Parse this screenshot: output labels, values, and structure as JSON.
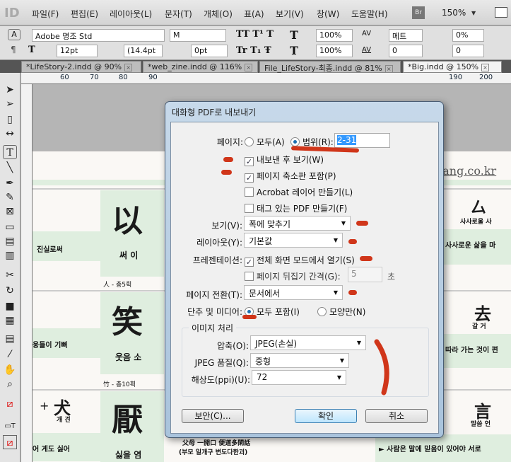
{
  "menubar": {
    "items": [
      "파일(F)",
      "편집(E)",
      "레이아웃(L)",
      "문자(T)",
      "개체(O)",
      "표(A)",
      "보기(V)",
      "창(W)",
      "도움말(H)"
    ],
    "bridge": "Br",
    "zoom": "150%"
  },
  "control": {
    "font": "Adobe 명조 Std",
    "style": "M",
    "size": "12pt",
    "leading": "(14.4pt",
    "baseline": "0pt",
    "vscale": "100%",
    "hscale": "100%",
    "kerning": "메트",
    "tracking": "0",
    "tsume": "0%",
    "grid": "0"
  },
  "tabs": [
    "*LifeStory-2.indd @ 90%",
    "*web_zine.indd @ 116%",
    "File_LifeStory-최종.indd @ 81%",
    "*Big.indd @ 150%"
  ],
  "ruler": [
    "60",
    "70",
    "80",
    "90",
    "190",
    "200"
  ],
  "document": {
    "url": "bang.co.kr",
    "c1": "以",
    "c1r": "써 이",
    "c1a": "진실로써",
    "c1f": "人 - 총5획",
    "c2": "笑",
    "c2r": "웃음 소",
    "c2a": "웅들이 기뻐",
    "c2f": "竹 - 총10획",
    "c3": "厭",
    "c3r": "싫을 염",
    "c3a": "어 게도 싫어",
    "c3b": "犬",
    "c3bl": "개 견",
    "r1": "厶",
    "r1l": "사사로울 사",
    "r1a": "사사로운 삶을 마",
    "r2": "去",
    "r2l": "갈 거",
    "r2a": "따라 가는 것이 편",
    "r3": "言",
    "r3l": "말씀 언",
    "r3a": "► 사람은 말에 믿음이 있어야 서로",
    "mid1": "父母 一開口 便道多閑話",
    "mid2": "(부모 일개구 변도다한괴)"
  },
  "dialog": {
    "title": "대화형 PDF로 내보내기",
    "pages_label": "페이지:",
    "all": "모두(A)",
    "range": "범위(R):",
    "range_value": "2-31",
    "view_after": "내보낸 후 보기(W)",
    "thumbs": "페이지 축소판 포함(P)",
    "layers": "Acrobat 레이어 만들기(L)",
    "tagged": "태그 있는 PDF 만들기(F)",
    "view_label": "보기(V):",
    "view_value": "폭에 맞추기",
    "layout_label": "레이아웃(Y):",
    "layout_value": "기본값",
    "pres_label": "프레젠테이션:",
    "fullscreen": "전체 화면 모드에서 열기(S)",
    "flip": "페이지 뒤집기 간격(G):",
    "flip_value": "5",
    "sec": "초",
    "trans_label": "페이지 전환(T):",
    "trans_value": "문서에서",
    "btn_label": "단추 및 미디어:",
    "include_all": "모두 포함(I)",
    "appearance": "모양만(N)",
    "image_group": "이미지 처리",
    "comp_label": "압축(O):",
    "comp_value": "JPEG(손실)",
    "quality_label": "JPEG 품질(Q):",
    "quality_value": "중형",
    "res_label": "해상도(ppi)(U):",
    "res_value": "72",
    "security": "보안(C)...",
    "ok": "확인",
    "cancel": "취소"
  }
}
